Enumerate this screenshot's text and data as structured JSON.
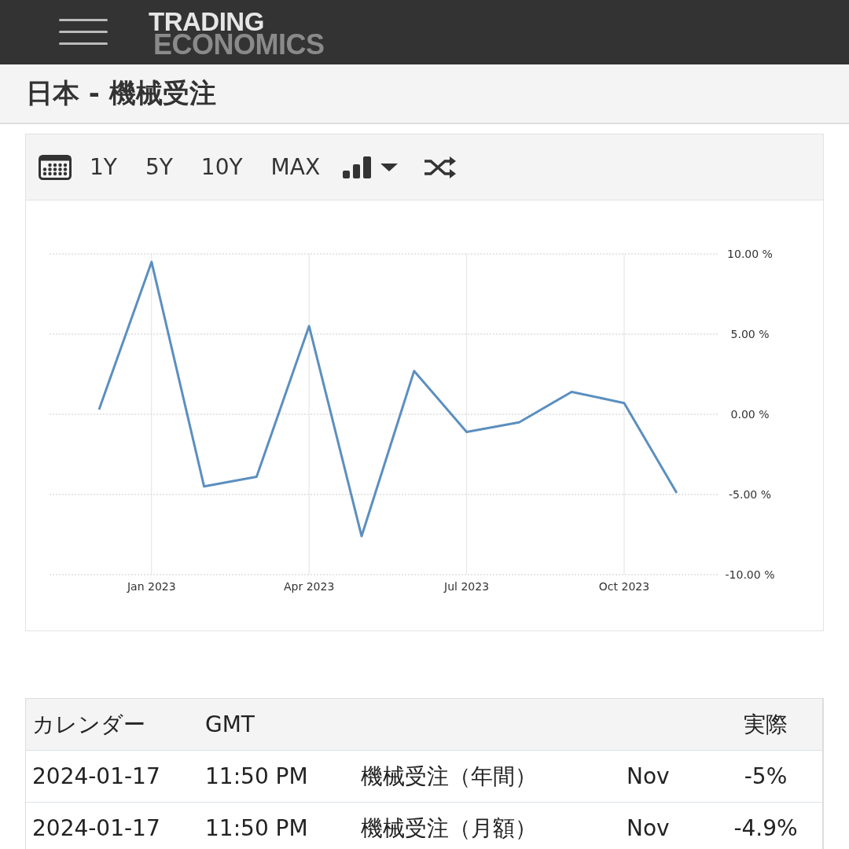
{
  "header": {
    "logo_top": "TRADING",
    "logo_bottom": "ECONOMICS"
  },
  "page_title": "日本 - 機械受注",
  "toolbar": {
    "ranges": [
      "1Y",
      "5Y",
      "10Y",
      "MAX"
    ]
  },
  "chart": {
    "chart_data": {
      "type": "line",
      "grid": true,
      "categories": [
        null,
        "Jan 2023",
        null,
        null,
        "Apr 2023",
        null,
        null,
        "Jul 2023",
        null,
        null,
        "Oct 2023",
        null
      ],
      "series": [
        {
          "color": "#5b8fbf",
          "values": [
            0.3,
            9.5,
            -4.5,
            -3.9,
            5.5,
            -7.6,
            2.7,
            -1.1,
            -0.5,
            1.4,
            0.7,
            -4.9
          ]
        }
      ],
      "ylim": [
        -10,
        10
      ],
      "yticks": [
        {
          "value": -10,
          "label": "-10.00 %"
        },
        {
          "value": -5,
          "label": "-5.00 %"
        },
        {
          "value": 0,
          "label": "0.00 %"
        },
        {
          "value": 5,
          "label": "5.00 %"
        },
        {
          "value": 10,
          "label": "10.00 %"
        }
      ]
    }
  },
  "table": {
    "columns": [
      {
        "label": "カレンダー"
      },
      {
        "label": "GMT"
      },
      {},
      {},
      {
        "label": "実際"
      }
    ],
    "rows": [
      {
        "cells": [
          "2024-01-17",
          "11:50 PM",
          "機械受注（年間）",
          "Nov",
          "-5%"
        ]
      },
      {
        "cells": [
          "2024-01-17",
          "11:50 PM",
          "機械受注（月額）",
          "Nov",
          "-4.9%"
        ]
      }
    ]
  }
}
